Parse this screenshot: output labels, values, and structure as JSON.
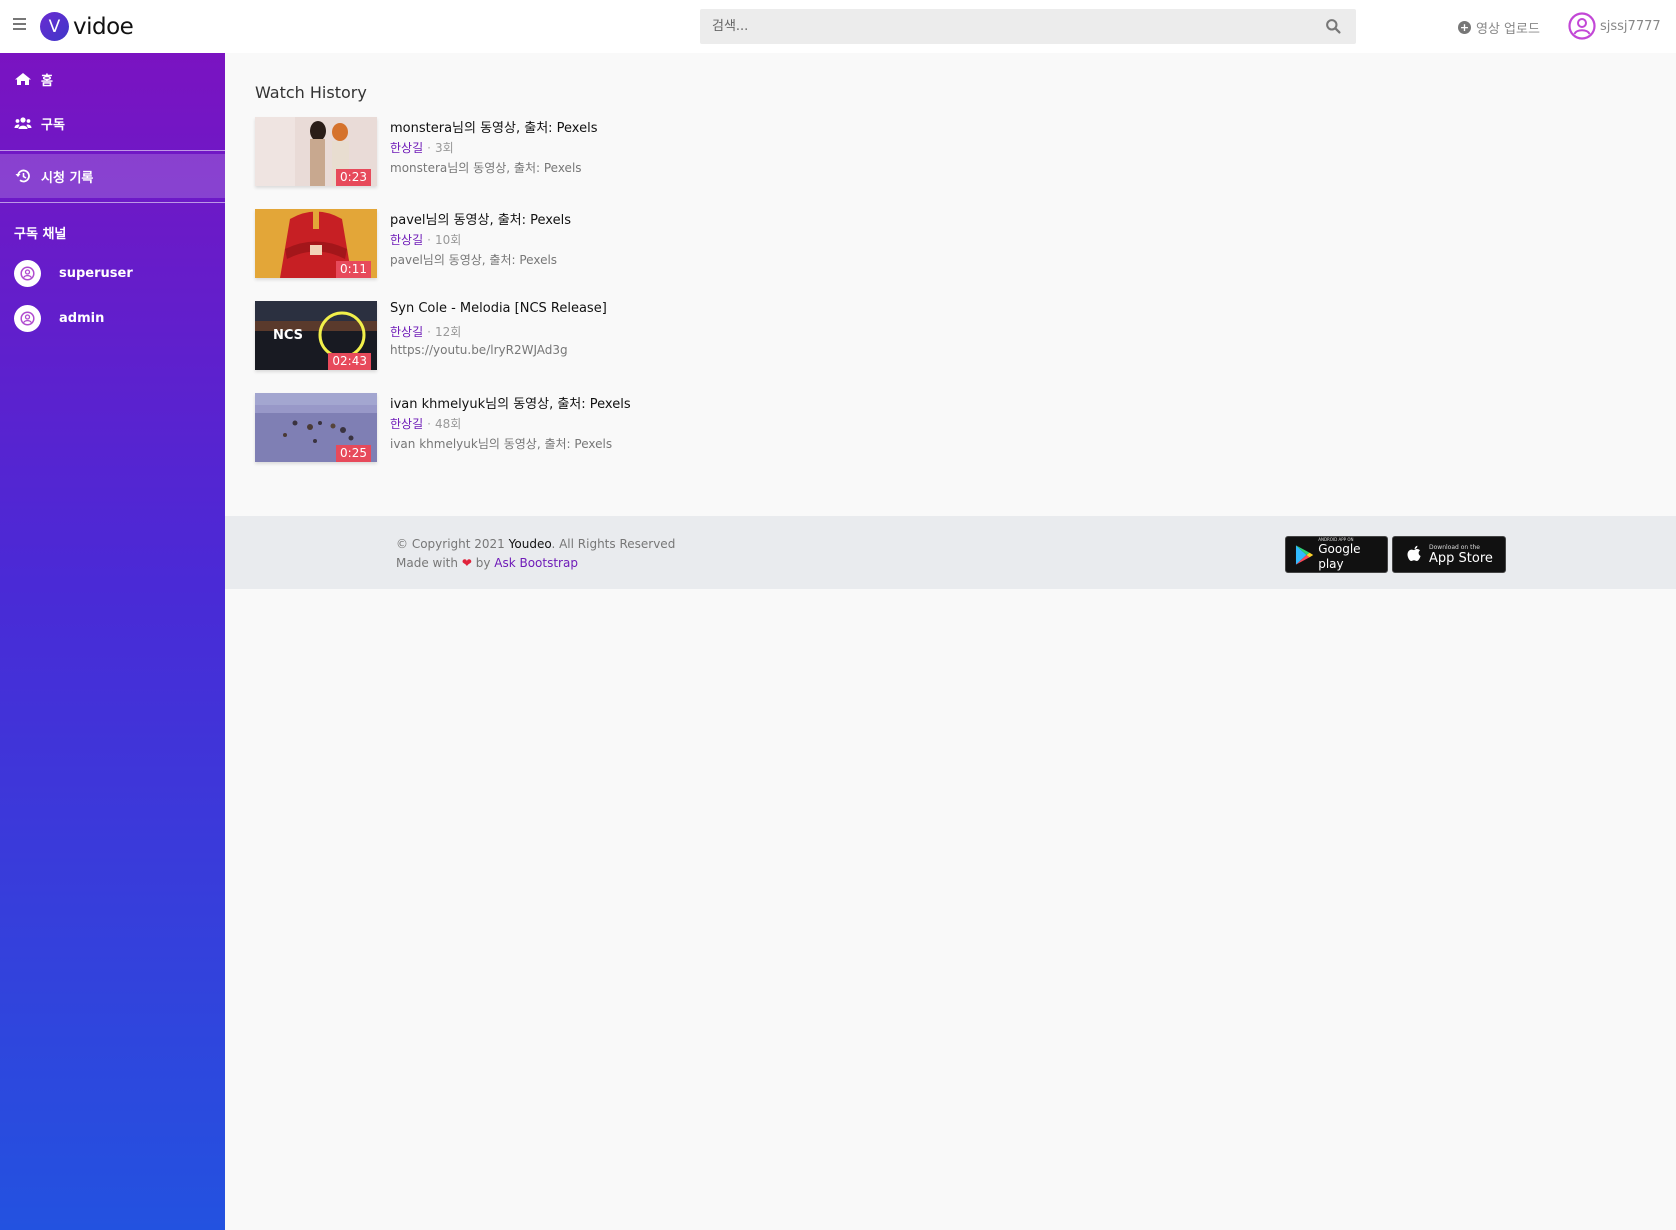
{
  "brand": {
    "logo_letter": "V",
    "name": "vidoe"
  },
  "search": {
    "placeholder": "검색..."
  },
  "header": {
    "upload_label": "영상 업로드",
    "username": "sjssj7777"
  },
  "sidebar": {
    "items": [
      {
        "label": "홈",
        "icon": "home-icon"
      },
      {
        "label": "구독",
        "icon": "users-icon"
      },
      {
        "label": "시청 기록",
        "icon": "history-icon",
        "active": true
      }
    ],
    "section_title": "구독 채널",
    "channels": [
      {
        "label": "superuser",
        "icon": "user-circle-icon"
      },
      {
        "label": "admin",
        "icon": "user-circle-icon"
      }
    ]
  },
  "main": {
    "title": "Watch History",
    "videos": [
      {
        "title": "monstera님의 동영상, 출처: Pexels",
        "channel": "한상길",
        "views": "3회",
        "description": "monstera님의 동영상, 출처: Pexels",
        "duration": "0:23"
      },
      {
        "title": "pavel님의 동영상, 출처: Pexels",
        "channel": "한상길",
        "views": "10회",
        "description": "pavel님의 동영상, 출처: Pexels",
        "duration": "0:11"
      },
      {
        "title": "Syn Cole - Melodia [NCS Release]",
        "channel": "한상길",
        "views": "12회",
        "description": "https://youtu.be/lryR2WJAd3g",
        "duration": "02:43",
        "thumb_text": "NCS"
      },
      {
        "title": "ivan khmelyuk님의 동영상, 출처: Pexels",
        "channel": "한상길",
        "views": "48회",
        "description": "ivan khmelyuk님의 동영상, 출처: Pexels",
        "duration": "0:25"
      }
    ]
  },
  "footer": {
    "copyright_prefix": "© Copyright 2021",
    "brand": "Youdeo",
    "copyright_suffix": ". All Rights Reserved",
    "made_with": "Made with",
    "heart": "❤",
    "by": "by",
    "credit_link": "Ask Bootstrap",
    "google_play": {
      "small": "ANDROID APP ON",
      "big": "Google play"
    },
    "app_store": {
      "small": "Download on the",
      "big": "App Store"
    }
  },
  "colors": {
    "accent": "#6f1bb8",
    "sidebar_top": "#7a13c1",
    "sidebar_bottom": "#2352e0",
    "duration_badge": "#e74a5b"
  }
}
